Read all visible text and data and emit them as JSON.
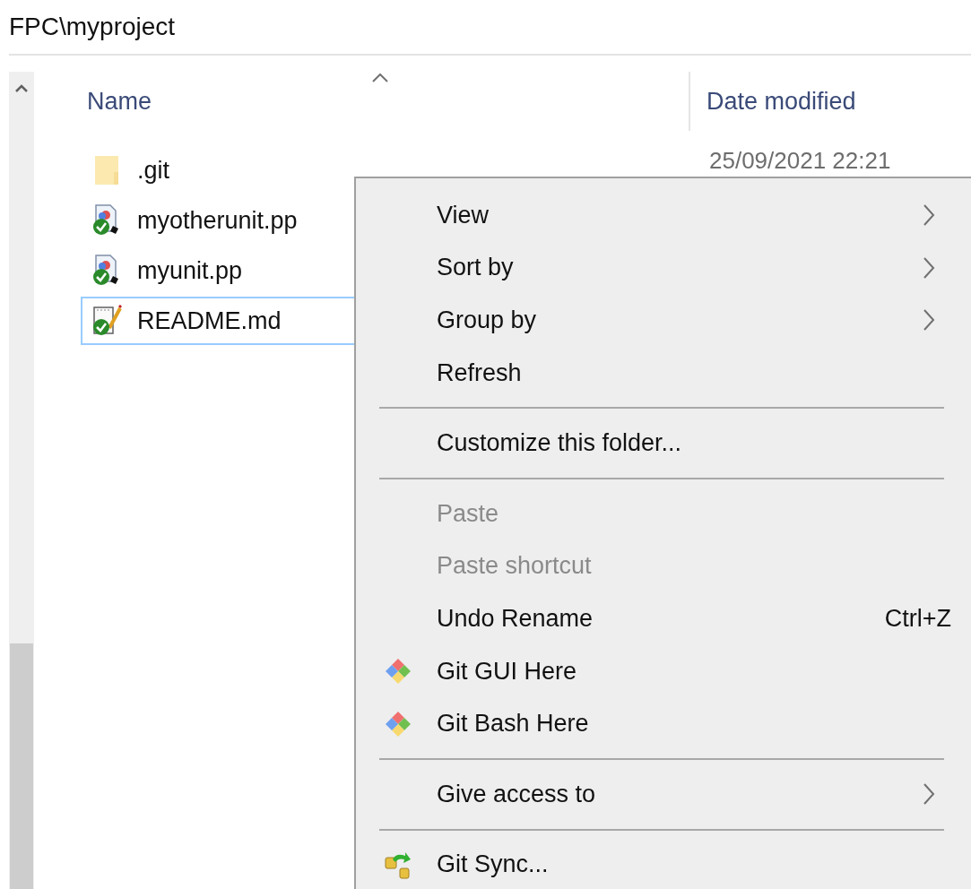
{
  "address_bar": {
    "path": "FPC\\myproject"
  },
  "columns": [
    {
      "label": "Name",
      "sorted": true
    },
    {
      "label": "Date modified",
      "sorted": false
    }
  ],
  "files": [
    {
      "name": ".git",
      "kind": "folder",
      "selected": false,
      "date": "25/09/2021 22:21"
    },
    {
      "name": "myotherunit.pp",
      "kind": "pascal",
      "selected": false
    },
    {
      "name": "myunit.pp",
      "kind": "pascal",
      "selected": false
    },
    {
      "name": "README.md",
      "kind": "text",
      "selected": true
    }
  ],
  "context_menu": {
    "items": [
      {
        "kind": "plain",
        "label": "View",
        "submenu": true,
        "disabled": false
      },
      {
        "kind": "plain",
        "label": "Sort by",
        "submenu": true,
        "disabled": false
      },
      {
        "kind": "plain",
        "label": "Group by",
        "submenu": true,
        "disabled": false
      },
      {
        "kind": "plain",
        "label": "Refresh",
        "submenu": false,
        "disabled": false
      },
      {
        "kind": "separator"
      },
      {
        "kind": "plain",
        "label": "Customize this folder...",
        "submenu": false,
        "disabled": false
      },
      {
        "kind": "separator"
      },
      {
        "kind": "plain",
        "label": "Paste",
        "submenu": false,
        "disabled": true
      },
      {
        "kind": "plain",
        "label": "Paste shortcut",
        "submenu": false,
        "disabled": true
      },
      {
        "kind": "plain",
        "label": "Undo Rename",
        "shortcut": "Ctrl+Z",
        "submenu": false,
        "disabled": false
      },
      {
        "kind": "git",
        "label": "Git GUI Here",
        "submenu": false,
        "disabled": false
      },
      {
        "kind": "git",
        "label": "Git Bash Here",
        "submenu": false,
        "disabled": false
      },
      {
        "kind": "separator"
      },
      {
        "kind": "plain",
        "label": "Give access to",
        "submenu": true,
        "disabled": false
      },
      {
        "kind": "separator"
      },
      {
        "kind": "sync",
        "label": "Git Sync...",
        "submenu": false,
        "disabled": false
      }
    ]
  }
}
